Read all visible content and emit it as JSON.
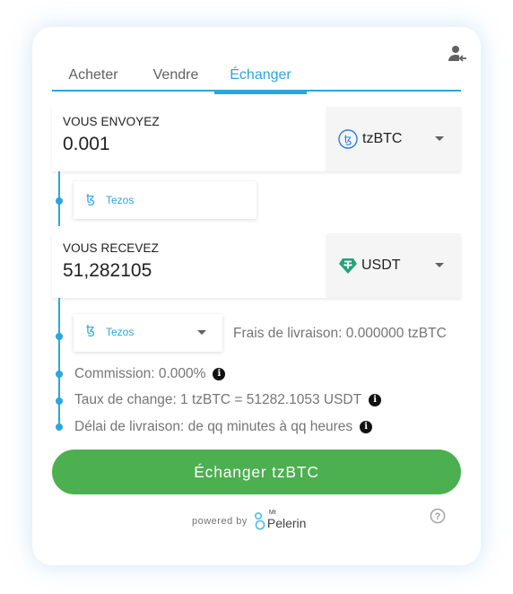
{
  "tabs": [
    {
      "label": "Acheter"
    },
    {
      "label": "Vendre"
    },
    {
      "label": "Échanger"
    }
  ],
  "active_tab": "Échanger",
  "send": {
    "label": "VOUS ENVOYEZ",
    "value": "0.001",
    "coin": "tzBTC",
    "coin_icon": "tzbtc-icon",
    "network": "Tezos",
    "network_icon": "tezos-icon"
  },
  "receive": {
    "label": "VOUS RECEVEZ",
    "value": "51,282105",
    "coin": "USDT",
    "coin_icon": "tether-icon",
    "network": "Tezos",
    "network_icon": "tezos-icon"
  },
  "fees": "Frais de livraison: 0.000000 tzBTC",
  "info": {
    "commission": "Commission: 0.000%",
    "rate": "Taux de change: 1 tzBTC = 51282.1053 USDT",
    "delay": "Délai de livraison: de qq minutes à qq heures"
  },
  "submit_label": "Échanger tzBTC",
  "footer": {
    "powered": "powered by",
    "logo_small": "Mt",
    "logo_text": "Pelerin"
  },
  "colors": {
    "accent": "#2ba6de",
    "submit": "#4caf50",
    "tether": "#26a17b"
  }
}
